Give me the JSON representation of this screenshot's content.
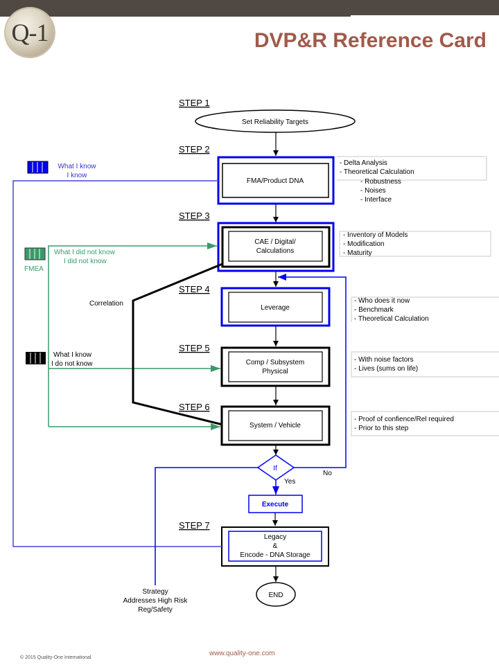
{
  "header": {
    "logo_text": "Q-1",
    "title": "DVP&R Reference Card"
  },
  "steps": [
    {
      "label": "STEP 1",
      "node": "Set Reliability Targets",
      "shape": "ellipse"
    },
    {
      "label": "STEP 2",
      "node": "FMA/Product DNA",
      "notes": [
        "- Delta Analysis",
        "- Theoretical Calculation",
        "- Robustness",
        "- Noises",
        "- Interface"
      ]
    },
    {
      "label": "STEP 3",
      "node_lines": [
        "CAE / Digital/",
        "Calculations"
      ],
      "notes": [
        "- Inventory of Models",
        "- Modification",
        "- Maturity"
      ]
    },
    {
      "label": "STEP 4",
      "node": "Leverage",
      "notes": [
        "- Who does it now",
        "- Benchmark",
        "- Theoretical Calculation"
      ]
    },
    {
      "label": "STEP 5",
      "node_lines": [
        "Comp / Subsystem",
        "Physical"
      ],
      "notes": [
        "- With noise factors",
        "- Lives  (sums on life)"
      ]
    },
    {
      "label": "STEP 6",
      "node": "System / Vehicle",
      "notes": [
        "- Proof of confience/Rel required",
        "- Prior to this step"
      ]
    },
    {
      "label": "STEP 7",
      "node_lines": [
        "Legacy",
        "&",
        "Encode - DNA Storage"
      ]
    }
  ],
  "decision": {
    "label": "If",
    "yes": "Yes",
    "no": "No"
  },
  "execute": "Execute",
  "end": "END",
  "legend": {
    "blue": {
      "lines": [
        "What I know",
        "I know"
      ],
      "color": "#0000ee"
    },
    "green": {
      "lines": [
        "What I did not know",
        "I did not know"
      ],
      "tag": "FMEA",
      "color": "#3a9a6a"
    },
    "black": {
      "lines": [
        "What I know",
        "I do not know"
      ],
      "color": "#000000"
    }
  },
  "correlation": "Correlation",
  "strategy": [
    "Strategy",
    "Addresses High Risk",
    "Reg/Safety"
  ],
  "footer": {
    "copyright": "© 2015 Quality-One International",
    "url": "www.quality-one.com"
  },
  "colors": {
    "title": "#a05a4a",
    "topbar": "#504842",
    "blue": "#0000ee",
    "green": "#3a9a6a"
  }
}
